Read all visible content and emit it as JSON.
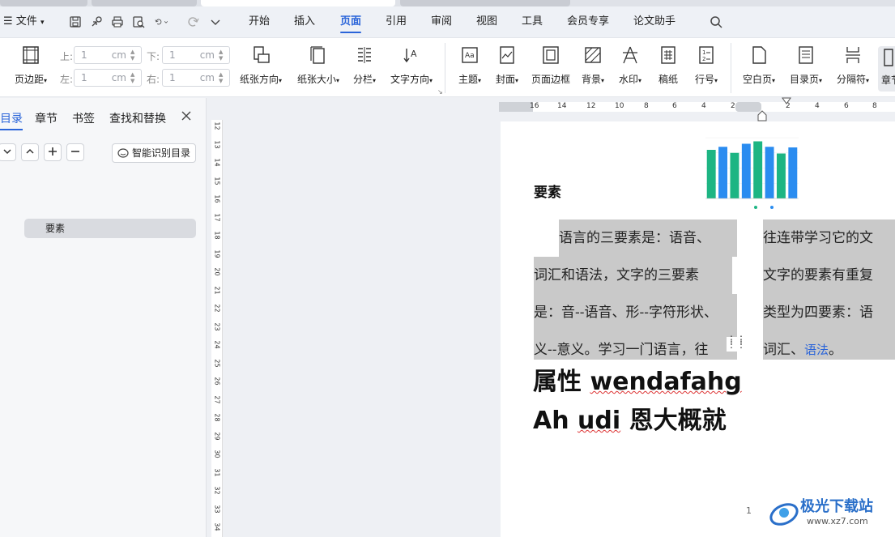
{
  "menu": {
    "file_label": "文件",
    "tabs": [
      {
        "label": "开始"
      },
      {
        "label": "插入"
      },
      {
        "label": "页面"
      },
      {
        "label": "引用"
      },
      {
        "label": "审阅"
      },
      {
        "label": "视图"
      },
      {
        "label": "工具"
      },
      {
        "label": "会员专享"
      },
      {
        "label": "论文助手"
      }
    ],
    "active_tab": "页面"
  },
  "ribbon": {
    "margins": {
      "label": "页边距",
      "top_label": "上:",
      "bottom_label": "下:",
      "left_label": "左:",
      "right_label": "右:",
      "top_value": "1",
      "bottom_value": "1",
      "left_value": "1",
      "right_value": "1",
      "unit": "cm"
    },
    "buttons": [
      {
        "label": "纸张方向"
      },
      {
        "label": "纸张大小"
      },
      {
        "label": "分栏"
      },
      {
        "label": "文字方向"
      },
      {
        "label": "主题"
      },
      {
        "label": "封面"
      },
      {
        "label": "页面边框"
      },
      {
        "label": "背景"
      },
      {
        "label": "水印"
      },
      {
        "label": "稿纸"
      },
      {
        "label": "行号"
      },
      {
        "label": "空白页"
      },
      {
        "label": "目录页"
      },
      {
        "label": "分隔符"
      },
      {
        "label": "章节"
      }
    ]
  },
  "nav": {
    "tabs": [
      {
        "label": "目录"
      },
      {
        "label": "章节"
      },
      {
        "label": "书签"
      },
      {
        "label": "查找和替换"
      }
    ],
    "smart_toc_label": "智能识别目录",
    "toc_items": [
      {
        "label": "要素"
      }
    ]
  },
  "vruler": [
    "12",
    "13",
    "14",
    "15",
    "16",
    "17",
    "18",
    "19",
    "20",
    "21",
    "22",
    "23",
    "24",
    "25",
    "26",
    "27",
    "28",
    "29",
    "30",
    "31",
    "32",
    "33",
    "34"
  ],
  "hruler": [
    "16",
    "14",
    "12",
    "10",
    "8",
    "6",
    "4",
    "2",
    "2",
    "4",
    "6",
    "8"
  ],
  "doc": {
    "heading": "要素",
    "col1_lines": [
      "语言的三要素是：语音、",
      "词汇和语法，文字的三要素",
      "是：音--语音、形--字符形状、",
      "义--意义。学习一门语言，往"
    ],
    "col2_lines": [
      "往连带学习它的文",
      "文字的要素有重复",
      "类型为四要素：语",
      "词汇、"
    ],
    "col2_link": "语法",
    "col2_end": "。",
    "big_line1_a": "属性 ",
    "big_line1_b": "wendafahg",
    "big_line2_a": "Ah ",
    "big_line2_b": "udi",
    "big_line2_c": " 恩大概就",
    "page_number": "1"
  },
  "chart_data": {
    "type": "bar",
    "categories": [
      "",
      "",
      "",
      "",
      "",
      "",
      "",
      ""
    ],
    "values": [
      0.8,
      0.85,
      0.75,
      0.9,
      0.94,
      0.85,
      0.74,
      0.84
    ],
    "colors": [
      "#1db583",
      "#2a8cf0"
    ],
    "ylim": [
      0,
      1
    ]
  },
  "watermark": {
    "title": "极光下载站",
    "url": "www.xz7.com"
  }
}
